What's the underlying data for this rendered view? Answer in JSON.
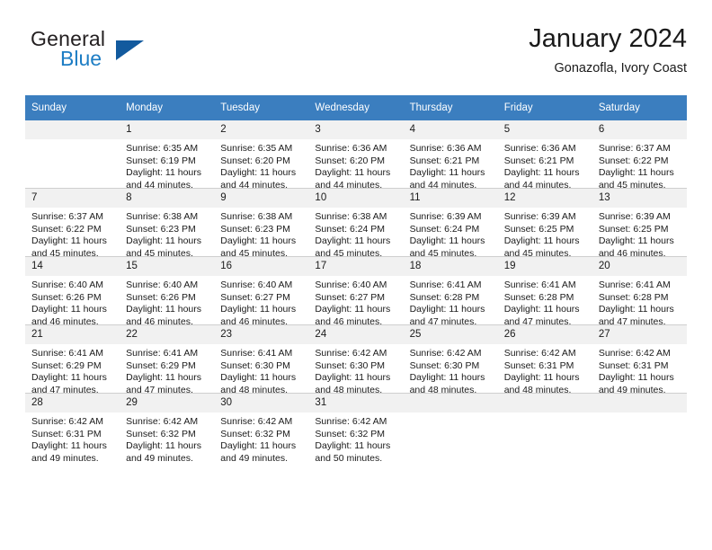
{
  "brand": {
    "name_part1": "General",
    "name_part2": "Blue",
    "colors": {
      "dark": "#231f20",
      "blue": "#1d7dc4",
      "triangle": "#125a9e"
    }
  },
  "header": {
    "title": "January 2024",
    "subtitle": "Gonazofla, Ivory Coast"
  },
  "theme": {
    "header_row_bg": "#3b7ebf",
    "header_row_text": "#ffffff",
    "daynum_bg": "#f1f1f1",
    "grid_line": "#cfcfcf"
  },
  "calendar": {
    "weekday_headers": [
      "Sunday",
      "Monday",
      "Tuesday",
      "Wednesday",
      "Thursday",
      "Friday",
      "Saturday"
    ],
    "weeks": [
      [
        {
          "day": "",
          "empty": true,
          "sunrise": "",
          "sunset": "",
          "daylight1": "",
          "daylight2": ""
        },
        {
          "day": "1",
          "sunrise": "Sunrise: 6:35 AM",
          "sunset": "Sunset: 6:19 PM",
          "daylight1": "Daylight: 11 hours",
          "daylight2": "and 44 minutes."
        },
        {
          "day": "2",
          "sunrise": "Sunrise: 6:35 AM",
          "sunset": "Sunset: 6:20 PM",
          "daylight1": "Daylight: 11 hours",
          "daylight2": "and 44 minutes."
        },
        {
          "day": "3",
          "sunrise": "Sunrise: 6:36 AM",
          "sunset": "Sunset: 6:20 PM",
          "daylight1": "Daylight: 11 hours",
          "daylight2": "and 44 minutes."
        },
        {
          "day": "4",
          "sunrise": "Sunrise: 6:36 AM",
          "sunset": "Sunset: 6:21 PM",
          "daylight1": "Daylight: 11 hours",
          "daylight2": "and 44 minutes."
        },
        {
          "day": "5",
          "sunrise": "Sunrise: 6:36 AM",
          "sunset": "Sunset: 6:21 PM",
          "daylight1": "Daylight: 11 hours",
          "daylight2": "and 44 minutes."
        },
        {
          "day": "6",
          "sunrise": "Sunrise: 6:37 AM",
          "sunset": "Sunset: 6:22 PM",
          "daylight1": "Daylight: 11 hours",
          "daylight2": "and 45 minutes."
        }
      ],
      [
        {
          "day": "7",
          "sunrise": "Sunrise: 6:37 AM",
          "sunset": "Sunset: 6:22 PM",
          "daylight1": "Daylight: 11 hours",
          "daylight2": "and 45 minutes."
        },
        {
          "day": "8",
          "sunrise": "Sunrise: 6:38 AM",
          "sunset": "Sunset: 6:23 PM",
          "daylight1": "Daylight: 11 hours",
          "daylight2": "and 45 minutes."
        },
        {
          "day": "9",
          "sunrise": "Sunrise: 6:38 AM",
          "sunset": "Sunset: 6:23 PM",
          "daylight1": "Daylight: 11 hours",
          "daylight2": "and 45 minutes."
        },
        {
          "day": "10",
          "sunrise": "Sunrise: 6:38 AM",
          "sunset": "Sunset: 6:24 PM",
          "daylight1": "Daylight: 11 hours",
          "daylight2": "and 45 minutes."
        },
        {
          "day": "11",
          "sunrise": "Sunrise: 6:39 AM",
          "sunset": "Sunset: 6:24 PM",
          "daylight1": "Daylight: 11 hours",
          "daylight2": "and 45 minutes."
        },
        {
          "day": "12",
          "sunrise": "Sunrise: 6:39 AM",
          "sunset": "Sunset: 6:25 PM",
          "daylight1": "Daylight: 11 hours",
          "daylight2": "and 45 minutes."
        },
        {
          "day": "13",
          "sunrise": "Sunrise: 6:39 AM",
          "sunset": "Sunset: 6:25 PM",
          "daylight1": "Daylight: 11 hours",
          "daylight2": "and 46 minutes."
        }
      ],
      [
        {
          "day": "14",
          "sunrise": "Sunrise: 6:40 AM",
          "sunset": "Sunset: 6:26 PM",
          "daylight1": "Daylight: 11 hours",
          "daylight2": "and 46 minutes."
        },
        {
          "day": "15",
          "sunrise": "Sunrise: 6:40 AM",
          "sunset": "Sunset: 6:26 PM",
          "daylight1": "Daylight: 11 hours",
          "daylight2": "and 46 minutes."
        },
        {
          "day": "16",
          "sunrise": "Sunrise: 6:40 AM",
          "sunset": "Sunset: 6:27 PM",
          "daylight1": "Daylight: 11 hours",
          "daylight2": "and 46 minutes."
        },
        {
          "day": "17",
          "sunrise": "Sunrise: 6:40 AM",
          "sunset": "Sunset: 6:27 PM",
          "daylight1": "Daylight: 11 hours",
          "daylight2": "and 46 minutes."
        },
        {
          "day": "18",
          "sunrise": "Sunrise: 6:41 AM",
          "sunset": "Sunset: 6:28 PM",
          "daylight1": "Daylight: 11 hours",
          "daylight2": "and 47 minutes."
        },
        {
          "day": "19",
          "sunrise": "Sunrise: 6:41 AM",
          "sunset": "Sunset: 6:28 PM",
          "daylight1": "Daylight: 11 hours",
          "daylight2": "and 47 minutes."
        },
        {
          "day": "20",
          "sunrise": "Sunrise: 6:41 AM",
          "sunset": "Sunset: 6:28 PM",
          "daylight1": "Daylight: 11 hours",
          "daylight2": "and 47 minutes."
        }
      ],
      [
        {
          "day": "21",
          "sunrise": "Sunrise: 6:41 AM",
          "sunset": "Sunset: 6:29 PM",
          "daylight1": "Daylight: 11 hours",
          "daylight2": "and 47 minutes."
        },
        {
          "day": "22",
          "sunrise": "Sunrise: 6:41 AM",
          "sunset": "Sunset: 6:29 PM",
          "daylight1": "Daylight: 11 hours",
          "daylight2": "and 47 minutes."
        },
        {
          "day": "23",
          "sunrise": "Sunrise: 6:41 AM",
          "sunset": "Sunset: 6:30 PM",
          "daylight1": "Daylight: 11 hours",
          "daylight2": "and 48 minutes."
        },
        {
          "day": "24",
          "sunrise": "Sunrise: 6:42 AM",
          "sunset": "Sunset: 6:30 PM",
          "daylight1": "Daylight: 11 hours",
          "daylight2": "and 48 minutes."
        },
        {
          "day": "25",
          "sunrise": "Sunrise: 6:42 AM",
          "sunset": "Sunset: 6:30 PM",
          "daylight1": "Daylight: 11 hours",
          "daylight2": "and 48 minutes."
        },
        {
          "day": "26",
          "sunrise": "Sunrise: 6:42 AM",
          "sunset": "Sunset: 6:31 PM",
          "daylight1": "Daylight: 11 hours",
          "daylight2": "and 48 minutes."
        },
        {
          "day": "27",
          "sunrise": "Sunrise: 6:42 AM",
          "sunset": "Sunset: 6:31 PM",
          "daylight1": "Daylight: 11 hours",
          "daylight2": "and 49 minutes."
        }
      ],
      [
        {
          "day": "28",
          "sunrise": "Sunrise: 6:42 AM",
          "sunset": "Sunset: 6:31 PM",
          "daylight1": "Daylight: 11 hours",
          "daylight2": "and 49 minutes."
        },
        {
          "day": "29",
          "sunrise": "Sunrise: 6:42 AM",
          "sunset": "Sunset: 6:32 PM",
          "daylight1": "Daylight: 11 hours",
          "daylight2": "and 49 minutes."
        },
        {
          "day": "30",
          "sunrise": "Sunrise: 6:42 AM",
          "sunset": "Sunset: 6:32 PM",
          "daylight1": "Daylight: 11 hours",
          "daylight2": "and 49 minutes."
        },
        {
          "day": "31",
          "sunrise": "Sunrise: 6:42 AM",
          "sunset": "Sunset: 6:32 PM",
          "daylight1": "Daylight: 11 hours",
          "daylight2": "and 50 minutes."
        },
        {
          "day": "",
          "empty": true,
          "sunrise": "",
          "sunset": "",
          "daylight1": "",
          "daylight2": ""
        },
        {
          "day": "",
          "empty": true,
          "sunrise": "",
          "sunset": "",
          "daylight1": "",
          "daylight2": ""
        },
        {
          "day": "",
          "empty": true,
          "sunrise": "",
          "sunset": "",
          "daylight1": "",
          "daylight2": ""
        }
      ]
    ]
  }
}
